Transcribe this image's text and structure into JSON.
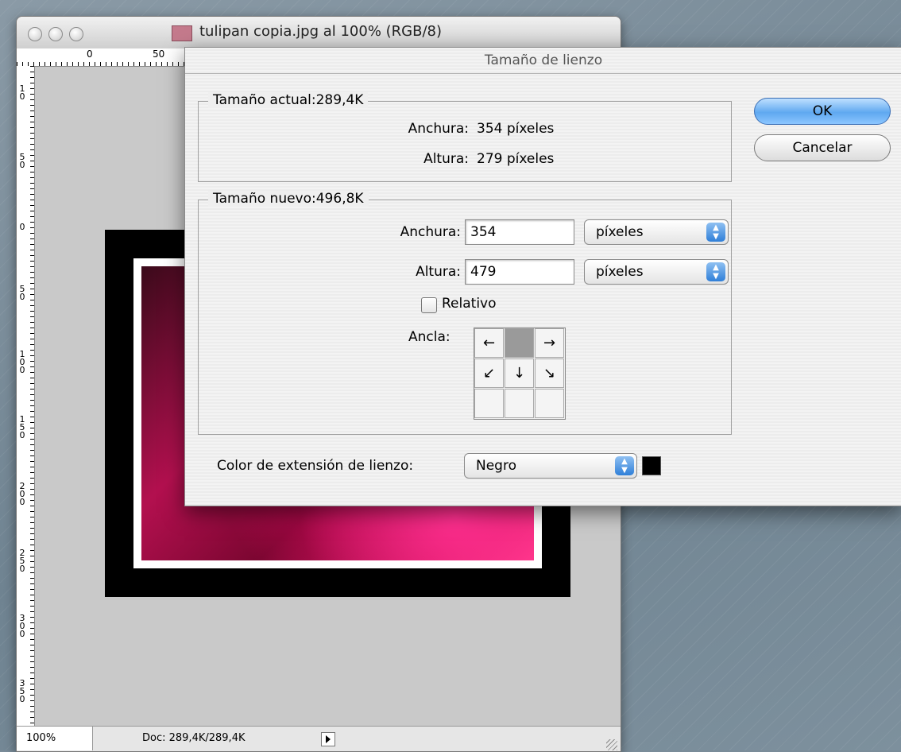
{
  "document_window": {
    "title": "tulipan copia.jpg al 100% (RGB/8)",
    "ruler_top_labels": [
      "0",
      "50"
    ],
    "ruler_left_labels": [
      "1 0",
      "5 0",
      "0",
      "5 0",
      "1 0 0",
      "1 5 0",
      "2 0 0",
      "2 5 0",
      "3 0 0",
      "3 5 0"
    ],
    "status": {
      "zoom": "100%",
      "doc_info": "Doc: 289,4K/289,4K"
    }
  },
  "dialog": {
    "title": "Tamaño de lienzo",
    "current": {
      "legend": "Tamaño actual:289,4K",
      "width_label": "Anchura:",
      "width_value": "354 píxeles",
      "height_label": "Altura:",
      "height_value": "279 píxeles"
    },
    "new": {
      "legend": "Tamaño nuevo:496,8K",
      "width_label": "Anchura:",
      "width_value": "354",
      "width_unit": "píxeles",
      "height_label": "Altura:",
      "height_value": "479",
      "height_unit": "píxeles",
      "relative_label": "Relativo",
      "relative_checked": false,
      "anchor_label": "Ancla:",
      "anchor_selected": "top-center"
    },
    "buttons": {
      "ok": "OK",
      "cancel": "Cancelar"
    },
    "extension": {
      "label": "Color de extensión de lienzo:",
      "value": "Negro",
      "swatch_color": "#000000"
    }
  },
  "icons": {
    "anchor_arrows": [
      "←",
      "",
      "→",
      "↙",
      "↓",
      "↘",
      "",
      "",
      ""
    ],
    "popup_arrows": "⇕"
  },
  "colors": {
    "ok_button": "#5fa8f0",
    "canvas_bg": "#c9c9c9",
    "petal": "#d0145e"
  }
}
